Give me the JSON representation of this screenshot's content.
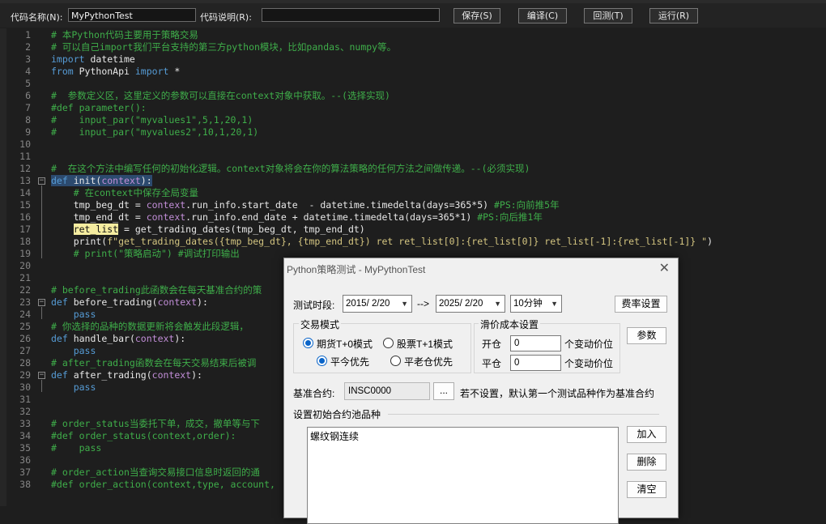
{
  "toolbar": {
    "code_name_label": "代码名称(N):",
    "code_name_value": "MyPythonTest",
    "code_desc_label": "代码说明(R):",
    "code_desc_value": "",
    "save": "保存(S)",
    "compile": "编译(C)",
    "backtest": "回测(T)",
    "run": "运行(R)"
  },
  "editor": {
    "lines": [
      {
        "n": "1",
        "t": "# 本Python代码主要用于策略交易"
      },
      {
        "n": "2",
        "t": "# 可以自己import我们平台支持的第三方python模块，比如pandas、numpy等。"
      },
      {
        "n": "3",
        "t": "import datetime"
      },
      {
        "n": "4",
        "t": "from PythonApi import *"
      },
      {
        "n": "5",
        "t": ""
      },
      {
        "n": "6",
        "t": "#  参数定义区，这里定义的参数可以直接在context对象中获取。--(选择实现)"
      },
      {
        "n": "7",
        "t": "#def parameter():"
      },
      {
        "n": "8",
        "t": "#    input_par(\"myvalues1\",5,1,20,1)"
      },
      {
        "n": "9",
        "t": "#    input_par(\"myvalues2\",10,1,20,1)"
      },
      {
        "n": "10",
        "t": ""
      },
      {
        "n": "11",
        "t": ""
      },
      {
        "n": "12",
        "t": "#  在这个方法中编写任何的初始化逻辑。context对象将会在你的算法策略的任何方法之间做传递。--(必须实现)"
      },
      {
        "n": "13",
        "t": "def init(context):"
      },
      {
        "n": "14",
        "t": "    # 在context中保存全局变量"
      },
      {
        "n": "15",
        "t": "    tmp_beg_dt = context.run_info.start_date  - datetime.timedelta(days=365*5) #PS:向前推5年"
      },
      {
        "n": "16",
        "t": "    tmp_end_dt = context.run_info.end_date + datetime.timedelta(days=365*1) #PS:向后推1年"
      },
      {
        "n": "17",
        "t": "    ret_list = get_trading_dates(tmp_beg_dt, tmp_end_dt)"
      },
      {
        "n": "18",
        "t": "    print(f\"get_trading_dates({tmp_beg_dt}, {tmp_end_dt}) ret ret_list[0]:{ret_list[0]} ret_list[-1]:{ret_list[-1]} \")"
      },
      {
        "n": "19",
        "t": "    # print(\"策略启动\") #调试打印输出"
      },
      {
        "n": "20",
        "t": ""
      },
      {
        "n": "21",
        "t": ""
      },
      {
        "n": "22",
        "t": "# before_trading此函数会在每天基准合约的策"
      },
      {
        "n": "23",
        "t": "def before_trading(context):"
      },
      {
        "n": "24",
        "t": "    pass"
      },
      {
        "n": "25",
        "t": "# 你选择的品种的数据更新将会触发此段逻辑，"
      },
      {
        "n": "26",
        "t": "def handle_bar(context):"
      },
      {
        "n": "27",
        "t": "    pass"
      },
      {
        "n": "28",
        "t": "# after_trading函数会在每天交易结束后被调"
      },
      {
        "n": "29",
        "t": "def after_trading(context):"
      },
      {
        "n": "30",
        "t": "    pass"
      },
      {
        "n": "31",
        "t": ""
      },
      {
        "n": "32",
        "t": ""
      },
      {
        "n": "33",
        "t": "# order_status当委托下单，成交，撤单等与下"
      },
      {
        "n": "34",
        "t": "#def order_status(context,order):"
      },
      {
        "n": "35",
        "t": "#    pass"
      },
      {
        "n": "36",
        "t": ""
      },
      {
        "n": "37",
        "t": "# order_action当查询交易接口信息时返回的通"
      },
      {
        "n": "38",
        "t": "#def order_action(context,type, account,"
      }
    ]
  },
  "dialog": {
    "title": "Python策略测试 - MyPythonTest",
    "test_period_label": "测试时段:",
    "start_date": "2015/ 2/20",
    "arrow": "-->",
    "end_date": "2025/ 2/20",
    "interval": "10分钟",
    "fee_button": "费率设置",
    "trade_mode_group": "交易模式",
    "mode_futures": "期货T+0模式",
    "mode_stock": "股票T+1模式",
    "close_today_first": "平今优先",
    "close_old_first": "平老仓优先",
    "slippage_group": "滑价成本设置",
    "open_label": "开仓",
    "open_value": "0",
    "close_label": "平仓",
    "close_value": "0",
    "tick_unit": "个变动价位",
    "params_button": "参数",
    "benchmark_label": "基准合约:",
    "benchmark_value": "INSC0000",
    "browse_button": "...",
    "benchmark_hint": "若不设置，默认第一个测试品种作为基准合约",
    "pool_label": "设置初始合约池品种",
    "pool_items": [
      "螺纹钢连续"
    ],
    "add_button": "加入",
    "delete_button": "删除",
    "clear_button": "清空"
  }
}
